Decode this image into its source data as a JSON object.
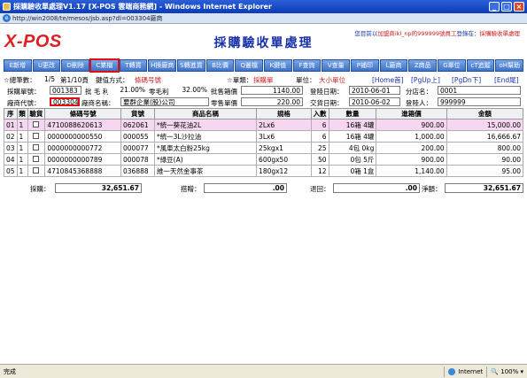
{
  "window": {
    "title": "採購驗收單處理V1.17 [X-POS 雲端商務網] - Windows Internet Explorer",
    "url": "http://win2008/te/mesos/jsb.asp?dl=003304廠商"
  },
  "app": {
    "logo": "X-POS",
    "page_title": "採購驗收單處理",
    "user_line_a": "您目前以",
    "user_line_b": "加盟商ikl_np的999999號員工",
    "user_line_c": "登錄在：",
    "user_line_d": "採購驗收單處理"
  },
  "toolbar": [
    {
      "key": "new",
      "label": "E新增"
    },
    {
      "key": "edit",
      "label": "U更改"
    },
    {
      "key": "del",
      "label": "D刪除"
    },
    {
      "key": "find",
      "label": "C業檔"
    },
    {
      "key": "post",
      "label": "T轉貨"
    },
    {
      "key": "vendor",
      "label": "H換廠商"
    },
    {
      "key": "transfer",
      "label": "S轉進貨"
    },
    {
      "key": "bprice",
      "label": "B比價"
    },
    {
      "key": "qfile",
      "label": "Q叢檔"
    },
    {
      "key": "keyin",
      "label": "K鍵值"
    },
    {
      "key": "query",
      "label": "F查詢"
    },
    {
      "key": "qty",
      "label": "V查量"
    },
    {
      "key": "print",
      "label": "P補印"
    },
    {
      "key": "lvendor",
      "label": "L廠商"
    },
    {
      "key": "zitem",
      "label": "Z商品"
    },
    {
      "key": "gunit",
      "label": "G單位"
    },
    {
      "key": "trace",
      "label": "cT追蹤"
    },
    {
      "key": "help",
      "label": "oH幫助"
    }
  ],
  "info": {
    "total_label": "☆總筆數：",
    "total_value": "1/5",
    "page_text": "第1/10頁",
    "keymode_label": "鍵值方式：",
    "keymode_value": "條碼号號",
    "mode_label": "☆單類：",
    "mode_value": "採購單",
    "unit_label": "單位：",
    "unit_value": "大小單位",
    "nav_home": "[Home首]",
    "nav_pgup": "[PgUp上]",
    "nav_pgdn": "[PgDn下]",
    "nav_end": "[End尾]"
  },
  "form": {
    "po_no_label": "採購單號：",
    "po_no": "001383",
    "margin_label": "批 毛 利",
    "margin_value": "21.00%",
    "zero_margin_label": "零毛利",
    "zero_margin_value": "32.00%",
    "box_price_label": "批售箱價",
    "box_price": "1140.00",
    "login_date_label": "登陸日期：",
    "login_date": "2010-06-01",
    "branch_label": "分店名：",
    "branch_value": "0001",
    "vendor_code_label": "廠商代號：",
    "vendor_code": "003304",
    "vendor_name_label": "廠商名稱：",
    "vendor_name": "要群企業(股)公司",
    "retail_price_label": "零售單價",
    "retail_price": "220.00",
    "trade_date_label": "交貨日期：",
    "trade_date": "2010-06-02",
    "login_user_label": "登陸人：",
    "login_user": "999999"
  },
  "grid": {
    "headers": [
      "序",
      "類",
      "驗貨",
      "條碼号號",
      "貨號",
      "商品名稱",
      "規格",
      "入數",
      "數量",
      "進箱價",
      "金額"
    ],
    "rows": [
      {
        "seq": "01",
        "cls": "1",
        "barcode": "4710088620613",
        "item_no": "062061",
        "name": "*統一葵花油2L",
        "spec": "2Lx6",
        "pack": "6",
        "qty": "16箱",
        "qty2": "4罐",
        "price": "900.00",
        "amount": "15,000.00"
      },
      {
        "seq": "02",
        "cls": "1",
        "barcode": "0000000000550",
        "item_no": "000055",
        "name": "*統一3L沙拉油",
        "spec": "3Lx6",
        "pack": "6",
        "qty": "16箱",
        "qty2": "4罐",
        "price": "1,000.00",
        "amount": "16,666.67"
      },
      {
        "seq": "03",
        "cls": "1",
        "barcode": "0000000000772",
        "item_no": "000077",
        "name": "*風車太白粉25kg",
        "spec": "25kgx1",
        "pack": "25",
        "qty": "4包",
        "qty2": "0kg",
        "price": "200.00",
        "amount": "800.00"
      },
      {
        "seq": "04",
        "cls": "1",
        "barcode": "0000000000789",
        "item_no": "000078",
        "name": "*綠豆(A)",
        "spec": "600gx50",
        "pack": "50",
        "qty": "0包",
        "qty2": "5斤",
        "price": "900.00",
        "amount": "90.00"
      },
      {
        "seq": "05",
        "cls": "1",
        "barcode": "4710845368888",
        "item_no": "036888",
        "name": "維一天然金事茶",
        "spec": "180gx12",
        "pack": "12",
        "qty": "0箱",
        "qty2": "1盒",
        "price": "1,140.00",
        "amount": "95.00"
      }
    ]
  },
  "totals": {
    "purchase_label": "採購：",
    "purchase_value": "32,651.67",
    "discount_label": "搭贈：",
    "discount_value": ".00",
    "return_label": "退回：",
    "return_value": ".00",
    "net_label": "淨額：",
    "net_value": "32,651.67"
  },
  "status": {
    "left": "完成",
    "zone": "Internet",
    "zoom": "100%"
  },
  "colors": {
    "accent": "#1830a8",
    "logo": "#e02020",
    "toolbar": "#3d73c9",
    "row_highlight": "#f6d6f0"
  }
}
